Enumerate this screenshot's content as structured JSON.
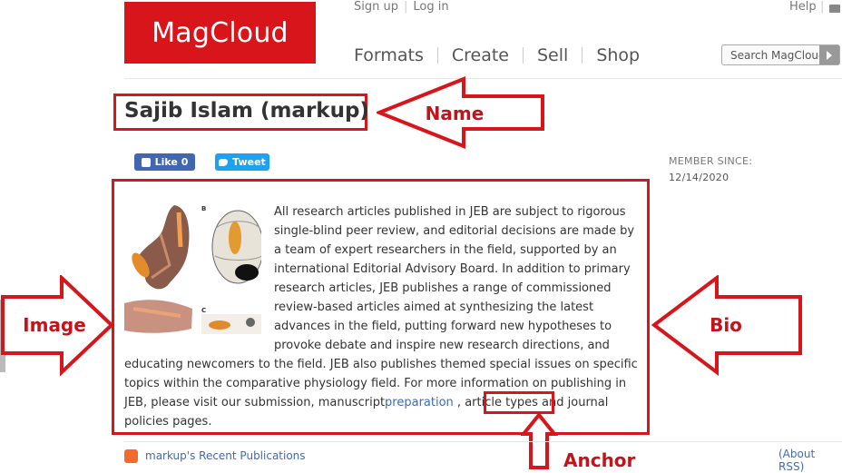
{
  "header": {
    "logo_text": "MagCloud",
    "signup": "Sign up",
    "login": "Log in",
    "help": "Help",
    "nav": [
      "Formats",
      "Create",
      "Sell",
      "Shop"
    ],
    "search_label": "Search MagCloud"
  },
  "profile": {
    "name": "Sajib Islam (markup)",
    "like_label": "Like 0",
    "tweet_label": "Tweet",
    "member_since_label": "MEMBER SINCE:",
    "member_since_value": "12/14/2020"
  },
  "bio": {
    "text_before_link": "All research articles published in JEB are subject to rigorous single-blind peer review, and editorial decisions are made by a team of expert researchers in the field, supported by an international Editorial Advisory Board. In addition to primary research articles, JEB publishes a range of commissioned review-based articles aimed at synthesizing the latest advances in the field, putting forward new hypotheses to provoke debate and inspire new research directions, and educating newcomers to the field. JEB also publishes themed special issues on specific topics within the comparative physiology field. For more information on publishing in JEB, please visit our submission, manuscript",
    "link_text": "preparation",
    "text_after_link": " , article types and journal policies pages.",
    "figure_labels": [
      "B",
      "C"
    ]
  },
  "footer": {
    "recent_publications": "markup's Recent Publications",
    "about_rss": "(About RSS)"
  },
  "annotations": {
    "name": "Name",
    "image": "Image",
    "bio": "Bio",
    "anchor": "Anchor"
  },
  "colors": {
    "brand_red": "#d7151a",
    "annotation_red": "#c0161b",
    "link_blue": "#3d6bb3",
    "facebook_blue": "#4267b2",
    "twitter_blue": "#1da1f2",
    "rss_orange": "#f26b2a"
  }
}
